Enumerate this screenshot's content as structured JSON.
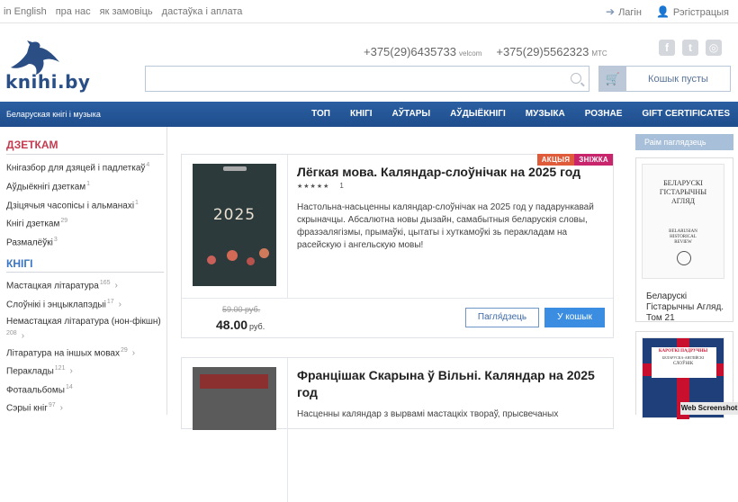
{
  "topbar": {
    "links": [
      "in English",
      "пра нас",
      "як замовіць",
      "дастаўка і аплата"
    ],
    "login": "Лагін",
    "register": "Рэгістрацыя"
  },
  "header": {
    "logo_text": "knihi.by",
    "phone1": "+375(29)6435733",
    "operator1": "velcom",
    "phone2": "+375(29)5562323",
    "operator2": "МТС",
    "search_placeholder": "",
    "cart_label": "Кошык пусты"
  },
  "navbar": {
    "tagline": "Беларуская кнігі і музыка",
    "items": [
      "ТОП",
      "КНІГІ",
      "АЎТАРЫ",
      "АЎДЫЁКНІГІ",
      "МУЗЫКА",
      "РОЗНАЕ",
      "GIFT CERTIFICATES"
    ]
  },
  "sidebar": {
    "section1": {
      "title": "ДЗЕТКАМ",
      "items": [
        {
          "label": "Кнігазбор для дзяцей і падлеткаў",
          "count": "4"
        },
        {
          "label": "Аўдыёкнігі дзеткам",
          "count": "1"
        },
        {
          "label": "Дзіцячыя часопісы і альманахі",
          "count": "1"
        },
        {
          "label": "Кнігі дзеткам",
          "count": "29"
        },
        {
          "label": "Размалёўкі",
          "count": "3"
        }
      ]
    },
    "section2": {
      "title": "КНІГІ",
      "items": [
        {
          "label": "Мастацкая літаратура",
          "count": "165"
        },
        {
          "label": "Слоўнікі і энцыклапэдыі",
          "count": "17"
        },
        {
          "label": "Немастацкая літаратура (нон-фікшн)",
          "count": "208"
        },
        {
          "label": "Літаратура на іншых мовах",
          "count": "29"
        },
        {
          "label": "Пераклады",
          "count": "121"
        },
        {
          "label": "Фотаальбомы",
          "count": "14"
        },
        {
          "label": "Сэрыі кніг",
          "count": "97"
        }
      ]
    }
  },
  "products": [
    {
      "badge1": "АКЦЫЯ",
      "badge2": "ЗНІЖКА",
      "cover_year": "2025",
      "title": "Лёгкая мова. Каляндар-слоўнічак на 2025 год",
      "stars": "★★★★★",
      "rating_count": "1",
      "description": "Настольна-насьценны каляндар-слоўнічак на 2025 год у падарункавай скрыначцы. Абсалютна новы дызайн, самабытныя беларускія словы, фразэалягізмы, прымаўкі, цытаты і хуткамоўкі зь перакладам на расейскую і ангельскую мовы!",
      "old_price": "59.00 руб.",
      "price": "48.00",
      "currency": "руб.",
      "view_label": "Пагля́дзець",
      "cart_label": "У кошык"
    },
    {
      "title_line1": "Францішак Скарына ў Вільні. Каляндар на 2025",
      "title_line2": "год",
      "description_partial": "Насценны каляндар з вырвамі мастацкіх твораў, прысвечаных"
    }
  ],
  "recommend": {
    "label": "Раім паглядзець",
    "book1": {
      "cover_lines": [
        "БЕЛАРУСКІ",
        "ГІСТАРЫЧНЫ",
        "АГЛЯД"
      ],
      "cover_sub": [
        "BELARUSIAN",
        "HISTORICAL",
        "REVIEW"
      ],
      "caption": [
        "Беларускі",
        "Гістарычны Агляд.",
        "Том 21"
      ]
    },
    "book2": {
      "cover_lines": [
        "КАРОТКІ ПАДРУЧНЫ",
        "БЕЛАРУСКА-АНГЛІЙСКІ",
        "СЛОЎНІК"
      ]
    }
  },
  "watermark": "Web Screenshot",
  "colors": {
    "nav_blue": "#2a5fa2",
    "section_red": "#c33b4f",
    "section_blue": "#3a76c4",
    "badge_orange": "#e05b3a",
    "badge_magenta": "#c9256d",
    "cart_button": "#3a8de0"
  }
}
